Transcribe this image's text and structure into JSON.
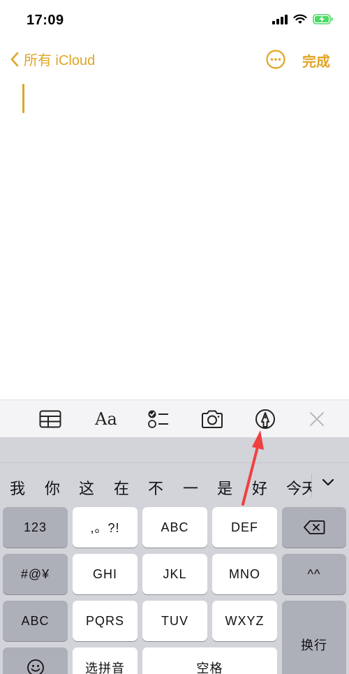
{
  "status_bar": {
    "time": "17:09"
  },
  "nav": {
    "back_label": "所有 iCloud",
    "ghost_text": "",
    "done_label": "完成"
  },
  "colors": {
    "accent": "#E0A526",
    "keyboard_bg": "#d2d4da",
    "arrow": "#f04040"
  },
  "toolbar": {
    "format_label": "Aa",
    "items": [
      "table-icon",
      "text-format",
      "checklist-icon",
      "camera-icon",
      "markup-icon",
      "close-icon"
    ]
  },
  "keyboard": {
    "candidates": [
      "我",
      "你",
      "这",
      "在",
      "不",
      "一",
      "是",
      "好",
      "今天"
    ],
    "rows": [
      [
        "123",
        ",。?!",
        "ABC",
        "DEF",
        "delete-icon"
      ],
      [
        "#@¥",
        "GHI",
        "JKL",
        "MNO",
        "^^"
      ],
      [
        "ABC",
        "PQRS",
        "TUV",
        "WXYZ",
        "换行"
      ],
      [
        "emoji-icon",
        "选拼音",
        "空格"
      ]
    ],
    "key_123": "123",
    "key_punct": ",。?!",
    "key_abc": "ABC",
    "key_def": "DEF",
    "key_symbols": "#@¥",
    "key_ghi": "GHI",
    "key_jkl": "JKL",
    "key_mno": "MNO",
    "key_emoticon": "^^",
    "key_abc_switch": "ABC",
    "key_pqrs": "PQRS",
    "key_tuv": "TUV",
    "key_wxyz": "WXYZ",
    "key_return": "换行",
    "key_pinyin": "选拼音",
    "key_space": "空格"
  }
}
